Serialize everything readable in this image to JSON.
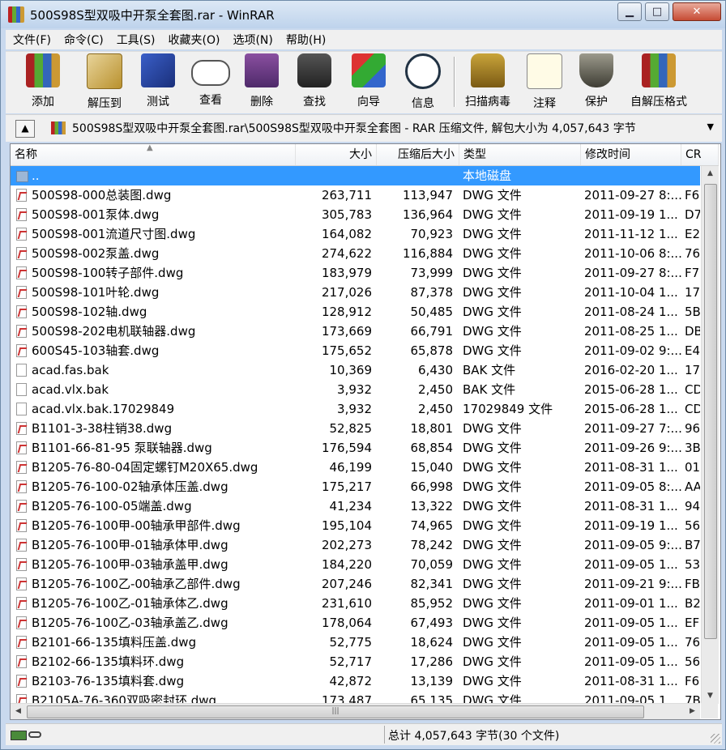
{
  "window": {
    "title": "500S98S型双吸中开泵全套图.rar - WinRAR"
  },
  "menu": [
    "文件(F)",
    "命令(C)",
    "工具(S)",
    "收藏夹(O)",
    "选项(N)",
    "帮助(H)"
  ],
  "toolbar": [
    {
      "label": "添加",
      "icon": "add-archive-icon"
    },
    {
      "label": "解压到",
      "icon": "extract-to-icon"
    },
    {
      "label": "测试",
      "icon": "test-icon"
    },
    {
      "label": "查看",
      "icon": "view-icon"
    },
    {
      "label": "删除",
      "icon": "delete-icon"
    },
    {
      "label": "查找",
      "icon": "find-icon"
    },
    {
      "label": "向导",
      "icon": "wizard-icon"
    },
    {
      "label": "信息",
      "icon": "info-icon"
    },
    {
      "label": "扫描病毒",
      "icon": "virus-scan-icon"
    },
    {
      "label": "注释",
      "icon": "comment-icon"
    },
    {
      "label": "保护",
      "icon": "protect-icon"
    },
    {
      "label": "自解压格式",
      "icon": "sfx-icon"
    }
  ],
  "address": {
    "path": "500S98S型双吸中开泵全套图.rar\\500S98S型双吸中开泵全套图 - RAR 压缩文件, 解包大小为 4,057,643 字节"
  },
  "columns": {
    "name": "名称",
    "size": "大小",
    "packed": "压缩后大小",
    "type": "类型",
    "modified": "修改时间",
    "crc": "CR"
  },
  "files": [
    {
      "name": "..",
      "size": "",
      "packed": "",
      "type": "本地磁盘",
      "modified": "",
      "crc": "",
      "icon": "folder",
      "selected": true
    },
    {
      "name": "500S98-000总装图.dwg",
      "size": "263,711",
      "packed": "113,947",
      "type": "DWG 文件",
      "modified": "2011-09-27 8:...",
      "crc": "F6",
      "icon": "dwg"
    },
    {
      "name": "500S98-001泵体.dwg",
      "size": "305,783",
      "packed": "136,964",
      "type": "DWG 文件",
      "modified": "2011-09-19 1...",
      "crc": "D7",
      "icon": "dwg"
    },
    {
      "name": "500S98-001流道尺寸图.dwg",
      "size": "164,082",
      "packed": "70,923",
      "type": "DWG 文件",
      "modified": "2011-11-12 1...",
      "crc": "E2",
      "icon": "dwg"
    },
    {
      "name": "500S98-002泵盖.dwg",
      "size": "274,622",
      "packed": "116,884",
      "type": "DWG 文件",
      "modified": "2011-10-06 8:...",
      "crc": "76",
      "icon": "dwg"
    },
    {
      "name": "500S98-100转子部件.dwg",
      "size": "183,979",
      "packed": "73,999",
      "type": "DWG 文件",
      "modified": "2011-09-27 8:...",
      "crc": "F7",
      "icon": "dwg"
    },
    {
      "name": "500S98-101叶轮.dwg",
      "size": "217,026",
      "packed": "87,378",
      "type": "DWG 文件",
      "modified": "2011-10-04 1...",
      "crc": "17",
      "icon": "dwg"
    },
    {
      "name": "500S98-102轴.dwg",
      "size": "128,912",
      "packed": "50,485",
      "type": "DWG 文件",
      "modified": "2011-08-24 1...",
      "crc": "5B",
      "icon": "dwg"
    },
    {
      "name": "500S98-202电机联轴器.dwg",
      "size": "173,669",
      "packed": "66,791",
      "type": "DWG 文件",
      "modified": "2011-08-25 1...",
      "crc": "DB",
      "icon": "dwg"
    },
    {
      "name": "600S45-103轴套.dwg",
      "size": "175,652",
      "packed": "65,878",
      "type": "DWG 文件",
      "modified": "2011-09-02 9:...",
      "crc": "E4",
      "icon": "dwg"
    },
    {
      "name": "acad.fas.bak",
      "size": "10,369",
      "packed": "6,430",
      "type": "BAK 文件",
      "modified": "2016-02-20 1...",
      "crc": "17",
      "icon": "blank"
    },
    {
      "name": "acad.vlx.bak",
      "size": "3,932",
      "packed": "2,450",
      "type": "BAK 文件",
      "modified": "2015-06-28 1...",
      "crc": "CD",
      "icon": "blank"
    },
    {
      "name": "acad.vlx.bak.17029849",
      "size": "3,932",
      "packed": "2,450",
      "type": "17029849 文件",
      "modified": "2015-06-28 1...",
      "crc": "CD",
      "icon": "blank"
    },
    {
      "name": "B1101-3-38柱销38.dwg",
      "size": "52,825",
      "packed": "18,801",
      "type": "DWG 文件",
      "modified": "2011-09-27 7:...",
      "crc": "96",
      "icon": "dwg"
    },
    {
      "name": "B1101-66-81-95 泵联轴器.dwg",
      "size": "176,594",
      "packed": "68,854",
      "type": "DWG 文件",
      "modified": "2011-09-26 9:...",
      "crc": "3B",
      "icon": "dwg"
    },
    {
      "name": "B1205-76-80-04固定螺钉M20X65.dwg",
      "size": "46,199",
      "packed": "15,040",
      "type": "DWG 文件",
      "modified": "2011-08-31 1...",
      "crc": "01",
      "icon": "dwg"
    },
    {
      "name": "B1205-76-100-02轴承体压盖.dwg",
      "size": "175,217",
      "packed": "66,998",
      "type": "DWG 文件",
      "modified": "2011-09-05 8:...",
      "crc": "AA",
      "icon": "dwg"
    },
    {
      "name": "B1205-76-100-05端盖.dwg",
      "size": "41,234",
      "packed": "13,322",
      "type": "DWG 文件",
      "modified": "2011-08-31 1...",
      "crc": "94",
      "icon": "dwg"
    },
    {
      "name": "B1205-76-100甲-00轴承甲部件.dwg",
      "size": "195,104",
      "packed": "74,965",
      "type": "DWG 文件",
      "modified": "2011-09-19 1...",
      "crc": "56",
      "icon": "dwg"
    },
    {
      "name": "B1205-76-100甲-01轴承体甲.dwg",
      "size": "202,273",
      "packed": "78,242",
      "type": "DWG 文件",
      "modified": "2011-09-05 9:...",
      "crc": "B7",
      "icon": "dwg"
    },
    {
      "name": "B1205-76-100甲-03轴承盖甲.dwg",
      "size": "184,220",
      "packed": "70,059",
      "type": "DWG 文件",
      "modified": "2011-09-05 1...",
      "crc": "53",
      "icon": "dwg"
    },
    {
      "name": "B1205-76-100乙-00轴承乙部件.dwg",
      "size": "207,246",
      "packed": "82,341",
      "type": "DWG 文件",
      "modified": "2011-09-21 9:...",
      "crc": "FB",
      "icon": "dwg"
    },
    {
      "name": "B1205-76-100乙-01轴承体乙.dwg",
      "size": "231,610",
      "packed": "85,952",
      "type": "DWG 文件",
      "modified": "2011-09-01 1...",
      "crc": "B2",
      "icon": "dwg"
    },
    {
      "name": "B1205-76-100乙-03轴承盖乙.dwg",
      "size": "178,064",
      "packed": "67,493",
      "type": "DWG 文件",
      "modified": "2011-09-05 1...",
      "crc": "EF",
      "icon": "dwg"
    },
    {
      "name": "B2101-66-135填料压盖.dwg",
      "size": "52,775",
      "packed": "18,624",
      "type": "DWG 文件",
      "modified": "2011-09-05 1...",
      "crc": "76",
      "icon": "dwg"
    },
    {
      "name": "B2102-66-135填料环.dwg",
      "size": "52,717",
      "packed": "17,286",
      "type": "DWG 文件",
      "modified": "2011-09-05 1...",
      "crc": "56",
      "icon": "dwg"
    },
    {
      "name": "B2103-76-135填料套.dwg",
      "size": "42,872",
      "packed": "13,139",
      "type": "DWG 文件",
      "modified": "2011-08-31 1...",
      "crc": "F6",
      "icon": "dwg"
    },
    {
      "name": "B2105A-76-360双吸密封环.dwg",
      "size": "173,487",
      "packed": "65,135",
      "type": "DWG 文件",
      "modified": "2011-09-05 1...",
      "crc": "7B",
      "icon": "dwg"
    }
  ],
  "status": {
    "text": "总计 4,057,643 字节(30 个文件)"
  }
}
